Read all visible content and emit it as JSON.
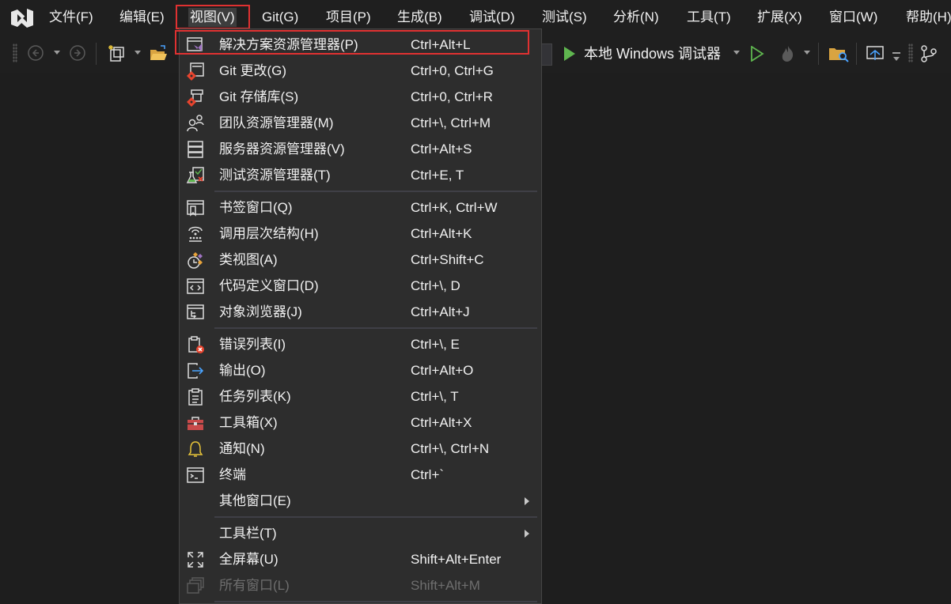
{
  "menubar": {
    "items": [
      {
        "label": "文件(F)"
      },
      {
        "label": "编辑(E)"
      },
      {
        "label": "视图(V)"
      },
      {
        "label": "Git(G)"
      },
      {
        "label": "项目(P)"
      },
      {
        "label": "生成(B)"
      },
      {
        "label": "调试(D)"
      },
      {
        "label": "测试(S)"
      },
      {
        "label": "分析(N)"
      },
      {
        "label": "工具(T)"
      },
      {
        "label": "扩展(X)"
      },
      {
        "label": "窗口(W)"
      },
      {
        "label": "帮助(H)"
      }
    ],
    "open_menu": "视图(V)"
  },
  "toolbar": {
    "debug_target_label": "本地 Windows 调试器",
    "icons": [
      "back-icon",
      "forward-icon",
      "new-project-icon",
      "open-folder-icon",
      "start-debug-icon",
      "start-without-debug-icon",
      "hot-reload-icon",
      "solution-explorer-search-icon",
      "publish-icon",
      "git-changes-icon"
    ]
  },
  "view_menu": {
    "items": [
      {
        "label": "解决方案资源管理器(P)",
        "shortcut": "Ctrl+Alt+L",
        "icon": "solution-explorer-icon",
        "highlighted": true
      },
      {
        "label": "Git 更改(G)",
        "shortcut": "Ctrl+0, Ctrl+G",
        "icon": "git-changes-icon"
      },
      {
        "label": "Git 存储库(S)",
        "shortcut": "Ctrl+0, Ctrl+R",
        "icon": "git-repository-icon"
      },
      {
        "label": "团队资源管理器(M)",
        "shortcut": "Ctrl+\\, Ctrl+M",
        "icon": "team-explorer-icon"
      },
      {
        "label": "服务器资源管理器(V)",
        "shortcut": "Ctrl+Alt+S",
        "icon": "server-explorer-icon"
      },
      {
        "label": "测试资源管理器(T)",
        "shortcut": "Ctrl+E, T",
        "icon": "test-explorer-icon"
      },
      {
        "label": "书签窗口(Q)",
        "shortcut": "Ctrl+K, Ctrl+W",
        "icon": "bookmark-window-icon"
      },
      {
        "label": "调用层次结构(H)",
        "shortcut": "Ctrl+Alt+K",
        "icon": "call-hierarchy-icon"
      },
      {
        "label": "类视图(A)",
        "shortcut": "Ctrl+Shift+C",
        "icon": "class-view-icon"
      },
      {
        "label": "代码定义窗口(D)",
        "shortcut": "Ctrl+\\, D",
        "icon": "code-definition-icon"
      },
      {
        "label": "对象浏览器(J)",
        "shortcut": "Ctrl+Alt+J",
        "icon": "object-browser-icon"
      },
      {
        "label": "错误列表(I)",
        "shortcut": "Ctrl+\\, E",
        "icon": "error-list-icon"
      },
      {
        "label": "输出(O)",
        "shortcut": "Ctrl+Alt+O",
        "icon": "output-icon"
      },
      {
        "label": "任务列表(K)",
        "shortcut": "Ctrl+\\, T",
        "icon": "task-list-icon"
      },
      {
        "label": "工具箱(X)",
        "shortcut": "Ctrl+Alt+X",
        "icon": "toolbox-icon"
      },
      {
        "label": "通知(N)",
        "shortcut": "Ctrl+\\, Ctrl+N",
        "icon": "notification-bell-icon"
      },
      {
        "label": "终端",
        "shortcut": "Ctrl+`",
        "icon": "terminal-icon"
      },
      {
        "label": "其他窗口(E)",
        "shortcut": "",
        "icon": "",
        "submenu": true
      },
      {
        "label": "工具栏(T)",
        "shortcut": "",
        "icon": "",
        "submenu": true
      },
      {
        "label": "全屏幕(U)",
        "shortcut": "Shift+Alt+Enter",
        "icon": "full-screen-icon"
      },
      {
        "label": "所有窗口(L)",
        "shortcut": "Shift+Alt+M",
        "icon": "all-windows-icon",
        "disabled": true
      }
    ]
  },
  "colors": {
    "background": "#1e1e1e",
    "menu_background": "#2d2d2d",
    "highlight_box": "#e03131",
    "accent_green": "#5fb64f",
    "accent_purple": "#a074c4"
  }
}
